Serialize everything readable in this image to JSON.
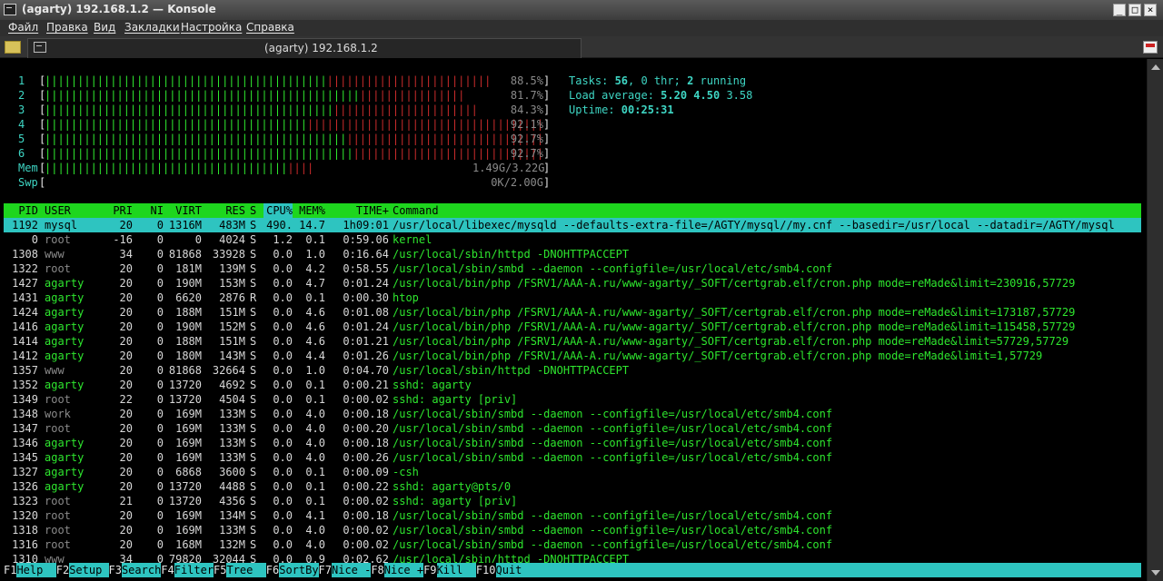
{
  "window": {
    "title": "(agarty) 192.168.1.2 — Konsole",
    "controls": [
      "_",
      "□",
      "×"
    ]
  },
  "menubar": [
    "Файл",
    "Правка",
    "Вид",
    "Закладки",
    "Настройка",
    "Справка"
  ],
  "tab": {
    "title": "(agarty) 192.168.1.2"
  },
  "cpu_meters": [
    {
      "label": "1",
      "green": 43,
      "red": 25,
      "value": "88.5%"
    },
    {
      "label": "2",
      "green": 48,
      "red": 16,
      "value": "81.7%"
    },
    {
      "label": "3",
      "green": 44,
      "red": 22,
      "value": "84.3%"
    },
    {
      "label": "4",
      "green": 40,
      "red": 36,
      "value": "92.1%"
    },
    {
      "label": "5",
      "green": 46,
      "red": 30,
      "value": "92.7%"
    },
    {
      "label": "6",
      "green": 47,
      "red": 29,
      "value": "92.7%"
    }
  ],
  "mem_meter": {
    "label": "Mem",
    "green": 37,
    "red": 4,
    "value": "1.49G/3.22G"
  },
  "swp_meter": {
    "label": "Swp",
    "value": "0K/2.00G"
  },
  "summary": {
    "tasks_label": "Tasks: ",
    "tasks": "56",
    "thr_label": ", 0 thr; ",
    "running": "2",
    "running_label": " running",
    "load_label": "Load average: ",
    "load1": "5.20",
    "load5": "4.50",
    "load15": "3.58",
    "uptime_label": "Uptime: ",
    "uptime": "00:25:31"
  },
  "columns": [
    "PID",
    "USER",
    "PRI",
    "NI",
    "VIRT",
    "RES",
    "S",
    "CPU%",
    "MEM%",
    "TIME+",
    "Command"
  ],
  "processes": [
    [
      "1192",
      "mysql",
      "20",
      "0",
      "1316M",
      "483M",
      "S",
      "490.",
      "14.7",
      "1h09:01",
      "/usr/local/libexec/mysqld --defaults-extra-file=/AGTY/mysql//my.cnf --basedir=/usr/local --datadir=/AGTY/mysql"
    ],
    [
      "0",
      "root",
      "-16",
      "0",
      "0",
      "4024",
      "S",
      "1.2",
      "0.1",
      "0:59.06",
      "kernel"
    ],
    [
      "1308",
      "www",
      "34",
      "0",
      "81868",
      "33928",
      "S",
      "0.0",
      "1.0",
      "0:16.64",
      "/usr/local/sbin/httpd -DNOHTTPACCEPT"
    ],
    [
      "1322",
      "root",
      "20",
      "0",
      "181M",
      "139M",
      "S",
      "0.0",
      "4.2",
      "0:58.55",
      "/usr/local/sbin/smbd --daemon --configfile=/usr/local/etc/smb4.conf"
    ],
    [
      "1427",
      "agarty",
      "20",
      "0",
      "190M",
      "153M",
      "S",
      "0.0",
      "4.7",
      "0:01.24",
      "/usr/local/bin/php /FSRV1/AAA-A.ru/www-agarty/_SOFT/certgrab.elf/cron.php mode=reMade&limit=230916,57729"
    ],
    [
      "1431",
      "agarty",
      "20",
      "0",
      "6620",
      "2876",
      "R",
      "0.0",
      "0.1",
      "0:00.30",
      "htop"
    ],
    [
      "1424",
      "agarty",
      "20",
      "0",
      "188M",
      "151M",
      "S",
      "0.0",
      "4.6",
      "0:01.08",
      "/usr/local/bin/php /FSRV1/AAA-A.ru/www-agarty/_SOFT/certgrab.elf/cron.php mode=reMade&limit=173187,57729"
    ],
    [
      "1416",
      "agarty",
      "20",
      "0",
      "190M",
      "152M",
      "S",
      "0.0",
      "4.6",
      "0:01.24",
      "/usr/local/bin/php /FSRV1/AAA-A.ru/www-agarty/_SOFT/certgrab.elf/cron.php mode=reMade&limit=115458,57729"
    ],
    [
      "1414",
      "agarty",
      "20",
      "0",
      "188M",
      "151M",
      "S",
      "0.0",
      "4.6",
      "0:01.21",
      "/usr/local/bin/php /FSRV1/AAA-A.ru/www-agarty/_SOFT/certgrab.elf/cron.php mode=reMade&limit=57729,57729"
    ],
    [
      "1412",
      "agarty",
      "20",
      "0",
      "180M",
      "143M",
      "S",
      "0.0",
      "4.4",
      "0:01.26",
      "/usr/local/bin/php /FSRV1/AAA-A.ru/www-agarty/_SOFT/certgrab.elf/cron.php mode=reMade&limit=1,57729"
    ],
    [
      "1357",
      "www",
      "20",
      "0",
      "81868",
      "32664",
      "S",
      "0.0",
      "1.0",
      "0:04.70",
      "/usr/local/sbin/httpd -DNOHTTPACCEPT"
    ],
    [
      "1352",
      "agarty",
      "20",
      "0",
      "13720",
      "4692",
      "S",
      "0.0",
      "0.1",
      "0:00.21",
      "sshd: agarty"
    ],
    [
      "1349",
      "root",
      "22",
      "0",
      "13720",
      "4504",
      "S",
      "0.0",
      "0.1",
      "0:00.02",
      "sshd: agarty [priv]"
    ],
    [
      "1348",
      "work",
      "20",
      "0",
      "169M",
      "133M",
      "S",
      "0.0",
      "4.0",
      "0:00.18",
      "/usr/local/sbin/smbd --daemon --configfile=/usr/local/etc/smb4.conf"
    ],
    [
      "1347",
      "root",
      "20",
      "0",
      "169M",
      "133M",
      "S",
      "0.0",
      "4.0",
      "0:00.20",
      "/usr/local/sbin/smbd --daemon --configfile=/usr/local/etc/smb4.conf"
    ],
    [
      "1346",
      "agarty",
      "20",
      "0",
      "169M",
      "133M",
      "S",
      "0.0",
      "4.0",
      "0:00.18",
      "/usr/local/sbin/smbd --daemon --configfile=/usr/local/etc/smb4.conf"
    ],
    [
      "1345",
      "agarty",
      "20",
      "0",
      "169M",
      "133M",
      "S",
      "0.0",
      "4.0",
      "0:00.26",
      "/usr/local/sbin/smbd --daemon --configfile=/usr/local/etc/smb4.conf"
    ],
    [
      "1327",
      "agarty",
      "20",
      "0",
      "6868",
      "3600",
      "S",
      "0.0",
      "0.1",
      "0:00.09",
      "-csh"
    ],
    [
      "1326",
      "agarty",
      "20",
      "0",
      "13720",
      "4488",
      "S",
      "0.0",
      "0.1",
      "0:00.22",
      "sshd: agarty@pts/0"
    ],
    [
      "1323",
      "root",
      "21",
      "0",
      "13720",
      "4356",
      "S",
      "0.0",
      "0.1",
      "0:00.02",
      "sshd: agarty [priv]"
    ],
    [
      "1320",
      "root",
      "20",
      "0",
      "169M",
      "134M",
      "S",
      "0.0",
      "4.1",
      "0:00.18",
      "/usr/local/sbin/smbd --daemon --configfile=/usr/local/etc/smb4.conf"
    ],
    [
      "1318",
      "root",
      "20",
      "0",
      "169M",
      "133M",
      "S",
      "0.0",
      "4.0",
      "0:00.02",
      "/usr/local/sbin/smbd --daemon --configfile=/usr/local/etc/smb4.conf"
    ],
    [
      "1316",
      "root",
      "20",
      "0",
      "168M",
      "132M",
      "S",
      "0.0",
      "4.0",
      "0:00.02",
      "/usr/local/sbin/smbd --daemon --configfile=/usr/local/etc/smb4.conf"
    ],
    [
      "1310",
      "www",
      "34",
      "0",
      "79820",
      "32044",
      "S",
      "0.0",
      "0.9",
      "0:02.62",
      "/usr/local/sbin/httpd -DNOHTTPACCEPT"
    ]
  ],
  "function_keys": [
    {
      "key": "F1",
      "label": "Help  "
    },
    {
      "key": "F2",
      "label": "Setup "
    },
    {
      "key": "F3",
      "label": "Search"
    },
    {
      "key": "F4",
      "label": "Filter"
    },
    {
      "key": "F5",
      "label": "Tree  "
    },
    {
      "key": "F6",
      "label": "SortBy"
    },
    {
      "key": "F7",
      "label": "Nice -"
    },
    {
      "key": "F8",
      "label": "Nice +"
    },
    {
      "key": "F9",
      "label": "Kill  "
    },
    {
      "key": "F10",
      "label": "Quit"
    }
  ],
  "colors": {
    "green": "#2ee62e",
    "red": "#c92b2b",
    "cyan": "#3ed6c4",
    "header_bg": "#1ed61e",
    "selection_bg": "#2ec4c0"
  }
}
